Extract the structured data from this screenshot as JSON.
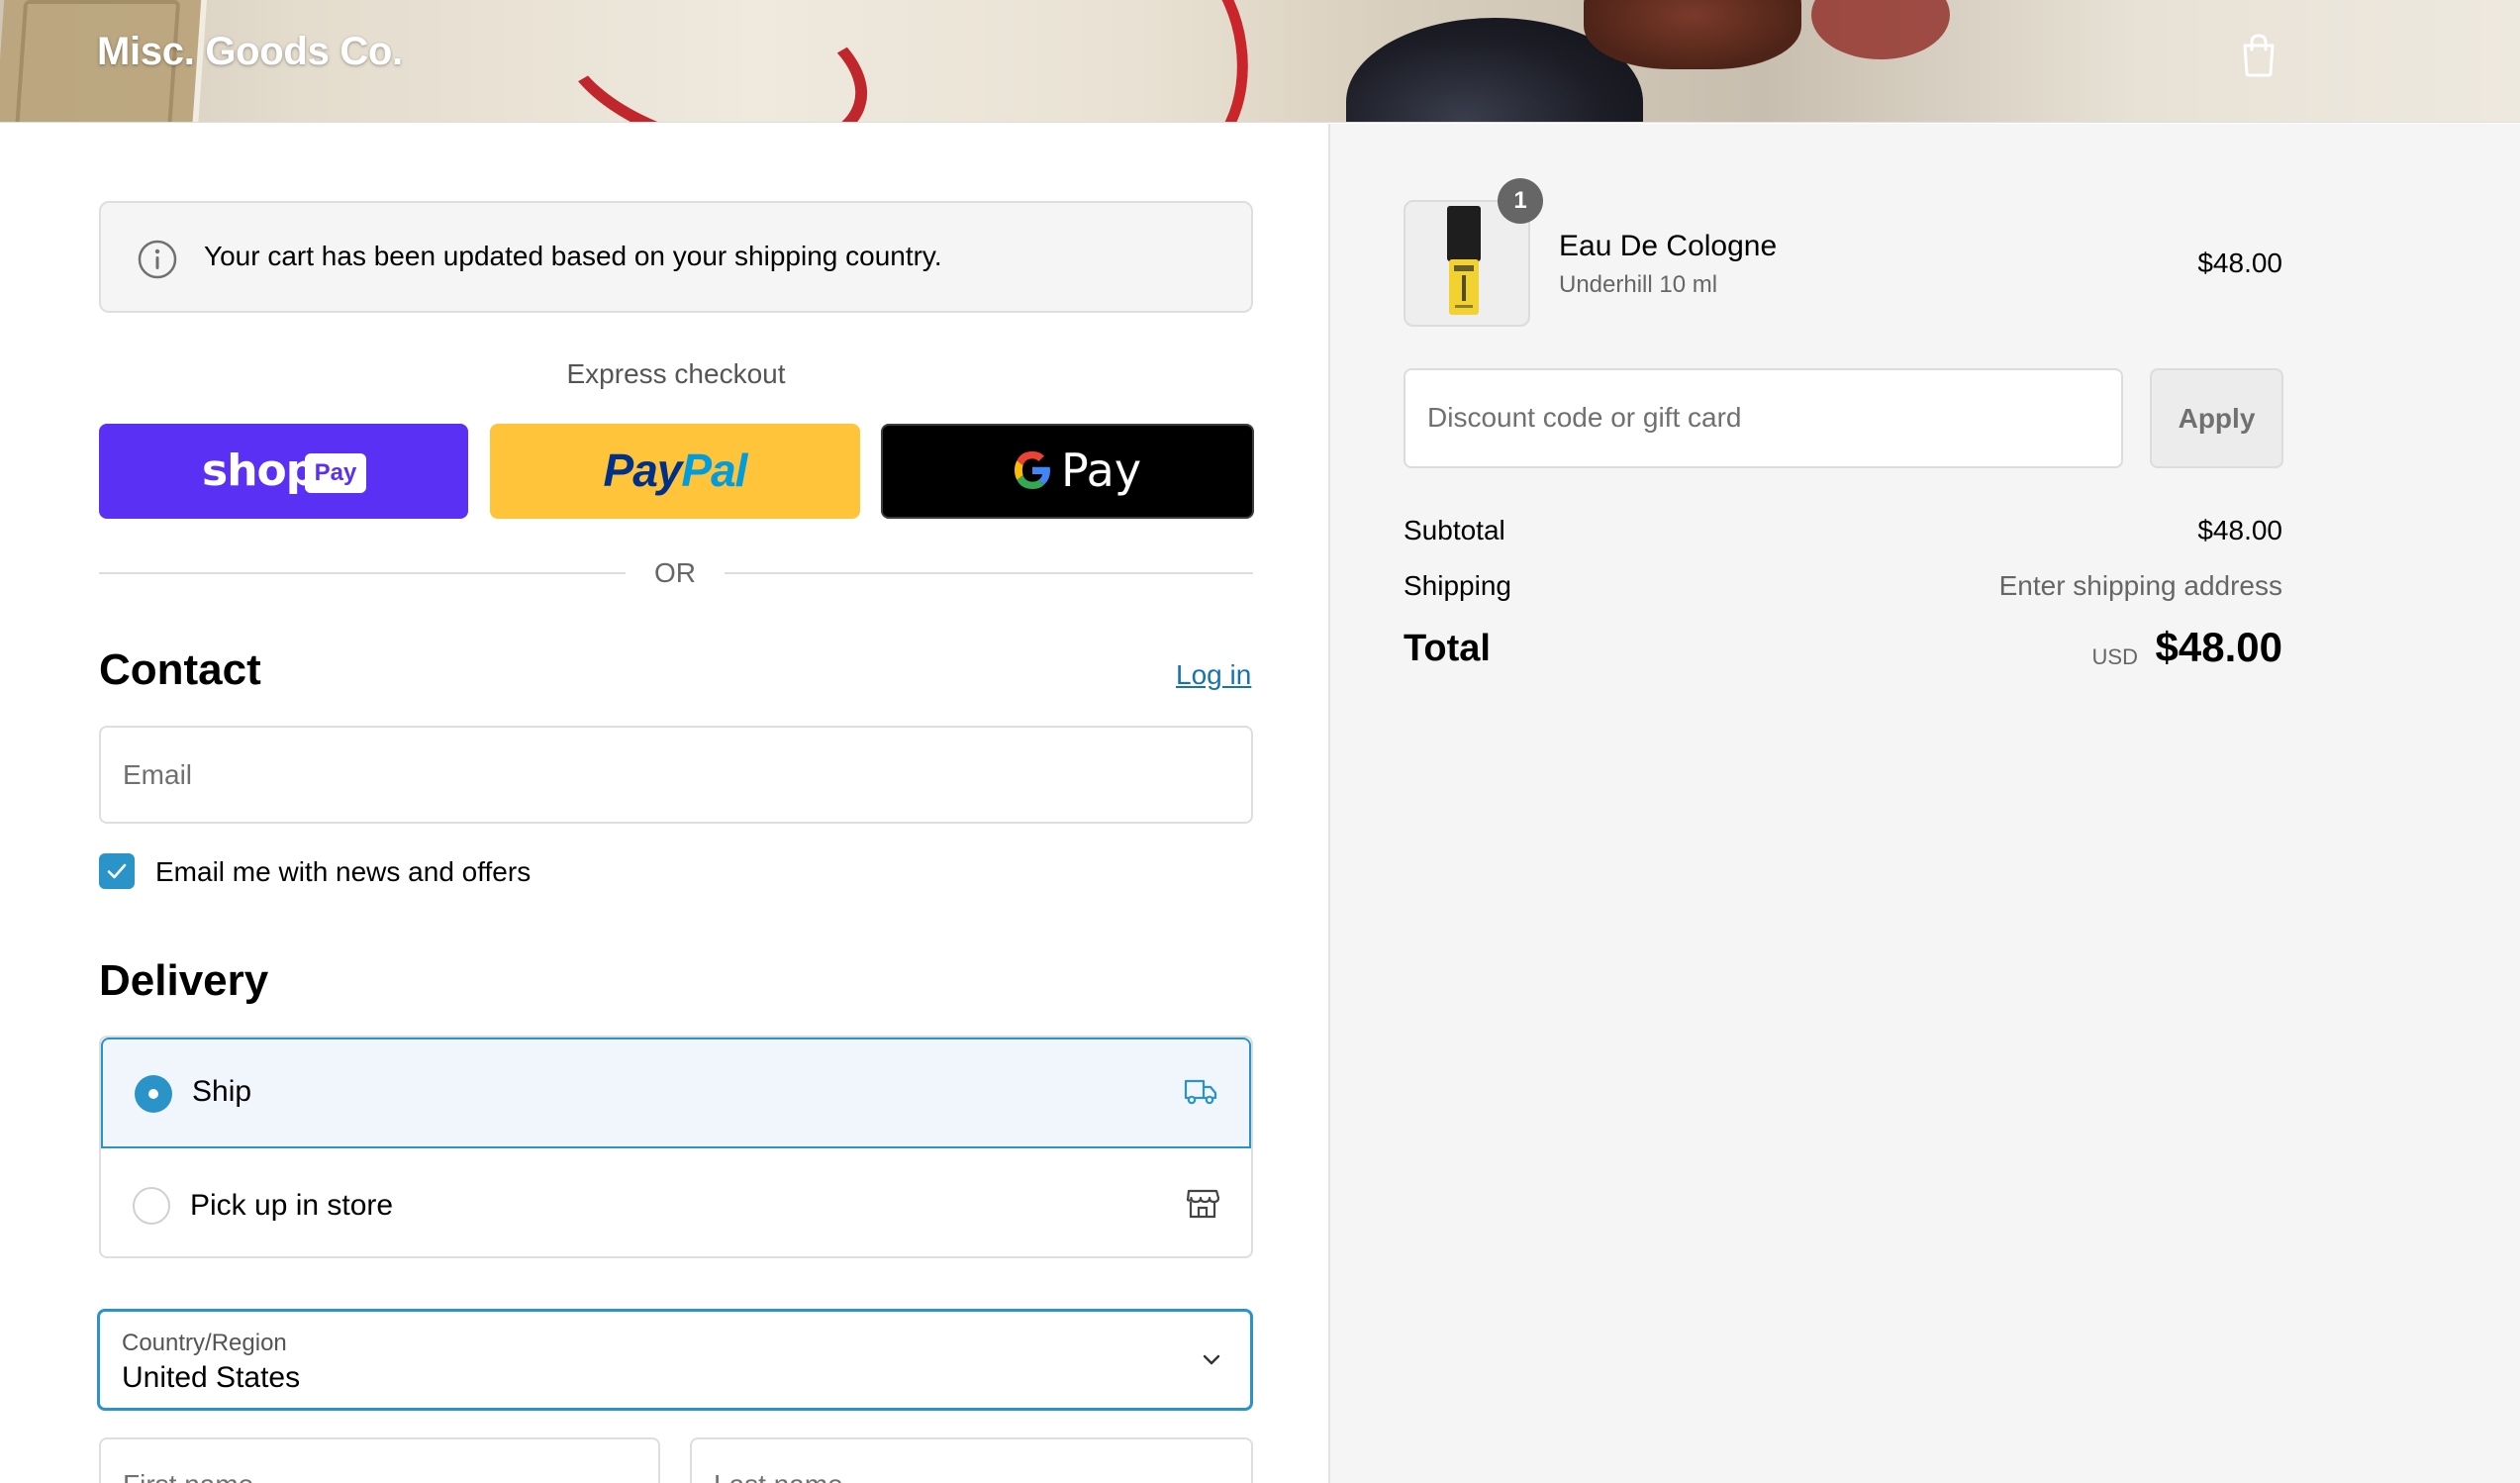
{
  "header": {
    "brand": "Misc. Goods Co."
  },
  "notice": {
    "text": "Your cart has been updated based on your shipping country."
  },
  "express": {
    "title": "Express checkout",
    "shop_pay": {
      "word": "shop",
      "tag": "Pay",
      "color": "#5a31f4"
    },
    "paypal": {
      "part1": "Pay",
      "part2": "Pal",
      "color": "#ffc439"
    },
    "gpay": {
      "text": "Pay"
    },
    "divider": "OR"
  },
  "contact": {
    "title": "Contact",
    "login_link": "Log in",
    "email_placeholder": "Email",
    "marketing_label": "Email me with news and offers",
    "marketing_checked": true
  },
  "delivery": {
    "title": "Delivery",
    "options": [
      {
        "label": "Ship",
        "selected": true,
        "icon": "truck-icon"
      },
      {
        "label": "Pick up in store",
        "selected": false,
        "icon": "store-icon"
      }
    ],
    "country_label": "Country/Region",
    "country_value": "United States",
    "first_name_placeholder": "First name",
    "last_name_placeholder": "Last name"
  },
  "summary": {
    "product": {
      "name": "Eau De Cologne",
      "variant": "Underhill 10 ml",
      "price": "$48.00",
      "quantity": "1"
    },
    "discount_placeholder": "Discount code or gift card",
    "apply_label": "Apply",
    "subtotal_label": "Subtotal",
    "subtotal_value": "$48.00",
    "shipping_label": "Shipping",
    "shipping_value": "Enter shipping address",
    "total_label": "Total",
    "total_currency": "USD",
    "total_value": "$48.00"
  },
  "colors": {
    "accent": "#2a94c9",
    "link": "#1773b0",
    "panel_bg": "#f5f5f5"
  }
}
